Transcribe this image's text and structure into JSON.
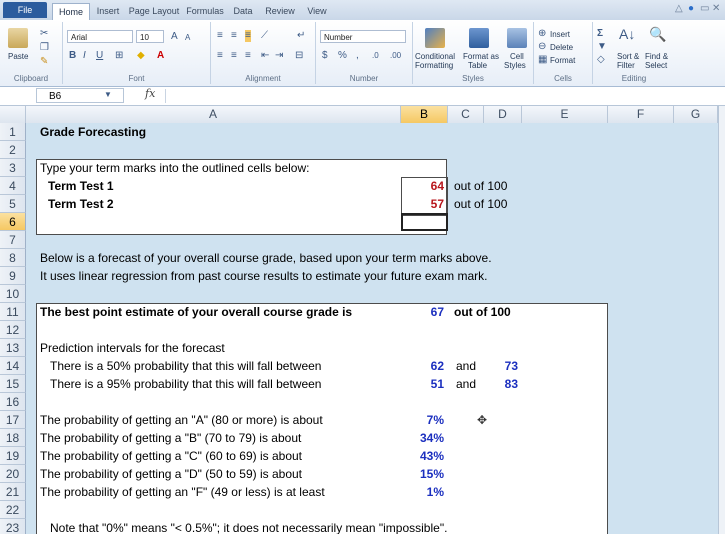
{
  "ribbon": {
    "tabs": [
      "File",
      "Home",
      "Insert",
      "Page Layout",
      "Formulas",
      "Data",
      "Review",
      "View"
    ],
    "font_name": "Arial",
    "font_size": "10",
    "number_format": "Number",
    "paste_label": "Paste",
    "clipboard_label": "Clipboard",
    "font_label": "Font",
    "alignment_label": "Alignment",
    "number_label": "Number",
    "conditional_label": "Conditional",
    "formatting_label": "Formatting",
    "format_as_label": "Format as",
    "table_label": "Table",
    "cell_label": "Cell",
    "styles_btn_label": "Styles",
    "styles_label": "Styles",
    "insert_label": "Insert",
    "delete_label": "Delete",
    "format_label": "Format",
    "cells_label": "Cells",
    "sort_label": "Sort &",
    "filter_label": "Filter",
    "find_label": "Find &",
    "select_label": "Select",
    "editing_label": "Editing"
  },
  "formula_bar": {
    "name_box": "B6",
    "fx": "fx",
    "formula": ""
  },
  "columns": [
    "A",
    "B",
    "C",
    "D",
    "E",
    "F",
    "G"
  ],
  "rows": [
    "1",
    "2",
    "3",
    "4",
    "5",
    "6",
    "7",
    "8",
    "9",
    "10",
    "11",
    "12",
    "13",
    "14",
    "15",
    "16",
    "17",
    "18",
    "19",
    "20",
    "21",
    "22",
    "23"
  ],
  "sheet": {
    "title": "Grade Forecasting",
    "instruction": "Type your term marks into the outlined cells below:",
    "test1_label": "Term Test 1",
    "test1_value": "64",
    "test1_outof": "out of 100",
    "test2_label": "Term Test 2",
    "test2_value": "57",
    "test2_outof": "out of 100",
    "forecast_line1": "Below is a forecast of your overall course grade, based upon your term marks above.",
    "forecast_line2": "It uses linear regression from past course results to estimate your future exam mark.",
    "estimate_label": "The best point estimate of your overall course grade is",
    "estimate_value": "67",
    "estimate_outof": "out of 100",
    "pi_heading": "Prediction intervals for the forecast",
    "pi50_label": "There is a 50% probability that this will fall between",
    "pi50_low": "62",
    "pi50_and": "and",
    "pi50_high": "73",
    "pi95_label": "There is a 95% probability that this will fall between",
    "pi95_low": "51",
    "pi95_and": "and",
    "pi95_high": "83",
    "probA_label": "The probability of getting an \"A\" (80 or more) is about",
    "probA_value": "7%",
    "probB_label": "The probability of getting a  \"B\" (70 to 79) is about",
    "probB_value": "34%",
    "probC_label": "The probability of getting a  \"C\" (60 to 69) is about",
    "probC_value": "43%",
    "probD_label": "The probability of getting a  \"D\" (50 to 59) is about",
    "probD_value": "15%",
    "probF_label": "The probability of getting an \"F\" (49 or less) is at least",
    "probF_value": "1%",
    "note": "Note that \"0%\" means \"< 0.5%\"; it does not necessarily mean \"impossible\"."
  },
  "colors": {
    "selection": "#f5c863",
    "input_value": "#b8161c",
    "output_value": "#1b2fbf"
  }
}
